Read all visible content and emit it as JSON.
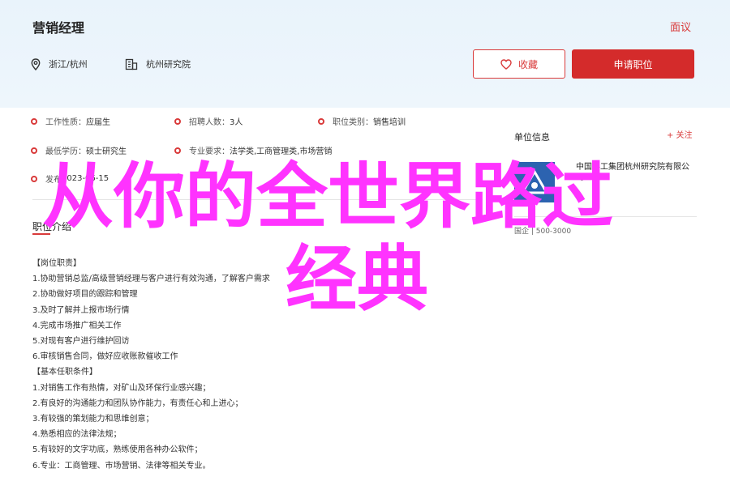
{
  "header": {
    "job_title": "营销经理",
    "report_label": "面议",
    "location": "浙江/杭州",
    "company": "杭州研究院",
    "favorite_label": "收藏",
    "apply_label": "申请职位"
  },
  "info": {
    "row1": [
      {
        "key": "工作性质：",
        "value": "应届生"
      },
      {
        "key": "招聘人数：",
        "value": "3人"
      },
      {
        "key": "职位类别：",
        "value": "销售培训"
      }
    ],
    "row2": [
      {
        "key": "最低学历：",
        "value": "硕士研究生"
      },
      {
        "key": "专业要求：",
        "value": "法学类,工商管理类,市场营销"
      }
    ],
    "row3": [
      {
        "key": "发布",
        "value": "2023-06-15"
      }
    ]
  },
  "section": {
    "title": "职位介绍"
  },
  "description": [
    "【岗位职责】",
    "1.协助营销总监/高级营销经理与客户进行有效沟通，了解客户需求",
    "2.协助做好项目的跟踪和管理",
    "3.及时了解并上报市场行情",
    "4.完成市场推广相关工作",
    "5.对现有客户进行维护回访",
    "6.审核销售合同，做好应收账款催收工作",
    "【基本任职条件】",
    "1.对销售工作有热情，对矿山及环保行业感兴趣；",
    "2.有良好的沟通能力和团队协作能力，有责任心和上进心；",
    "3.有较强的策划能力和思维创意；",
    "4.熟悉相应的法律法规；",
    "5.有较好的文字功底，熟练使用各种办公软件；",
    "6.专业：工商管理、市场营销、法律等相关专业。"
  ],
  "company_panel": {
    "title": "单位信息",
    "follow_label": "+ 关注",
    "name": "中国科工集团杭州研究院有限公司",
    "meta": "国企 | 500-3000"
  },
  "overlay": {
    "line1": "从你的全世界路过",
    "line2": "经典"
  },
  "colors": {
    "accent": "#d93a3a",
    "apply_bg": "#d42b2b",
    "header_bg": "#e9f3fb",
    "overlay": "#ff33ff"
  }
}
